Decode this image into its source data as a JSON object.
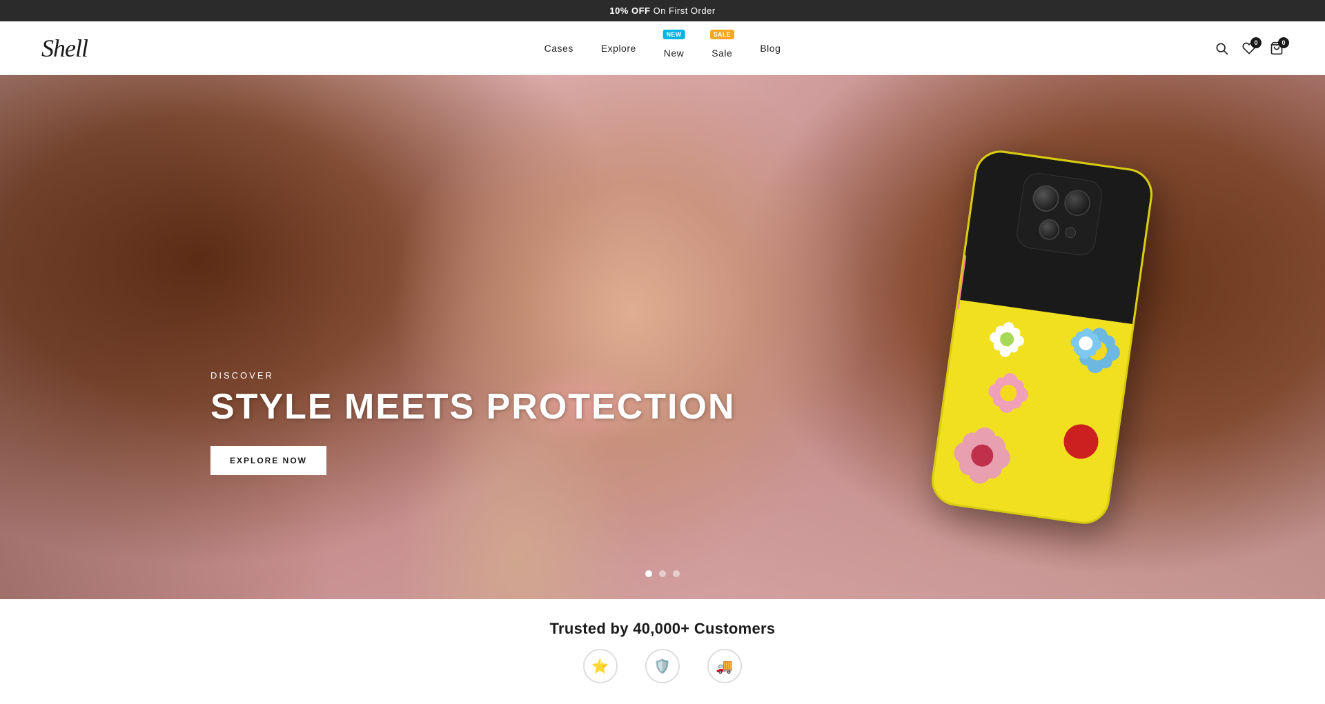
{
  "announcement": {
    "text_highlight": "10% OFF",
    "text_rest": " On First Order"
  },
  "header": {
    "logo": "Shell",
    "nav": [
      {
        "id": "cases",
        "label": "Cases",
        "badge": null
      },
      {
        "id": "explore",
        "label": "Explore",
        "badge": null
      },
      {
        "id": "new",
        "label": "New",
        "badge": "New",
        "badge_type": "new"
      },
      {
        "id": "sale",
        "label": "Sale",
        "badge": "Sale",
        "badge_type": "sale"
      },
      {
        "id": "blog",
        "label": "Blog",
        "badge": null
      }
    ],
    "icons": {
      "search": "🔍",
      "wishlist_count": "0",
      "cart_count": "0"
    }
  },
  "hero": {
    "discover_label": "DISCOVER",
    "title": "STYLE MEETS PROTECTION",
    "cta_label": "EXPLORE NOW",
    "slides_count": 3,
    "active_slide": 0
  },
  "trusted": {
    "text": "Trusted by 40,000+ Customers"
  }
}
